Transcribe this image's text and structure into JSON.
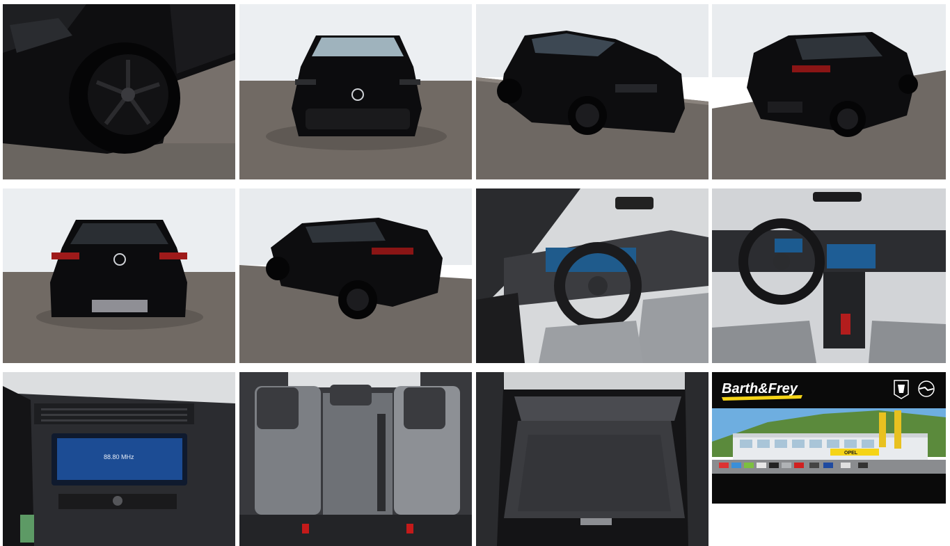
{
  "gallery": {
    "photos": [
      {
        "subject": "front-wheel-closeup"
      },
      {
        "subject": "front-view"
      },
      {
        "subject": "front-three-quarter-view"
      },
      {
        "subject": "rear-three-quarter-view-left"
      },
      {
        "subject": "rear-view"
      },
      {
        "subject": "rear-three-quarter-view-right"
      },
      {
        "subject": "driver-cockpit"
      },
      {
        "subject": "dashboard-center"
      },
      {
        "subject": "infotainment-screen"
      },
      {
        "subject": "rear-seats"
      },
      {
        "subject": "trunk"
      },
      {
        "subject": "dealer-banner"
      }
    ],
    "infotainment": {
      "radio_frequency": "88.80 MHz"
    },
    "dealer": {
      "name": "Barth&Frey",
      "logos": [
        "peugeot-lion-icon",
        "opel-blitz-icon"
      ],
      "sign": "OPEL"
    }
  },
  "colors": {
    "car_body": "#0d0d0f",
    "studio_wall": "#e9ecef",
    "studio_floor": "#6f6964",
    "banner_black": "#0a0a0a",
    "brand_yellow": "#f5d417"
  }
}
